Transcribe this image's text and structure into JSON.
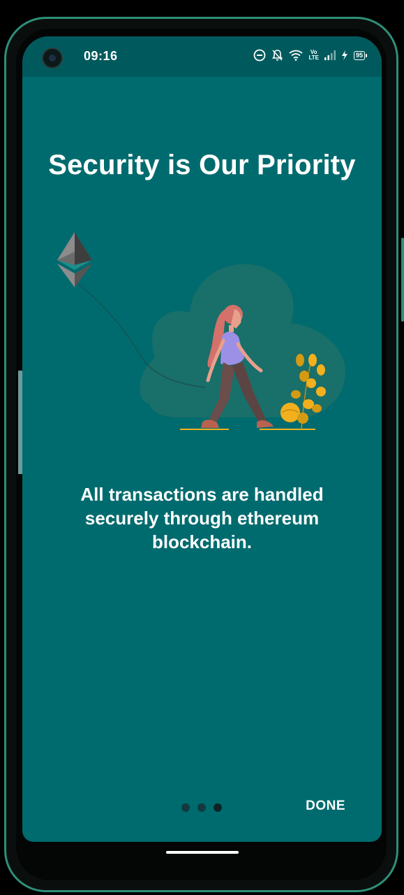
{
  "status_bar": {
    "time": "09:16",
    "lte_top": "Vo",
    "lte_bottom": "LTE",
    "battery": "95"
  },
  "onboarding": {
    "title": "Security is Our Priority",
    "description": "All transactions are handled securely through ethereum blockchain.",
    "done_label": "DONE",
    "page_count": 3,
    "current_page": 3
  },
  "colors": {
    "screen_bg": "#006b6e",
    "status_bg": "#005a5d",
    "accent": "#f2b01e"
  },
  "icons": [
    "dnd-icon",
    "mute-icon",
    "wifi-icon",
    "signal-icon",
    "charging-icon",
    "battery-icon",
    "ethereum-logo"
  ]
}
